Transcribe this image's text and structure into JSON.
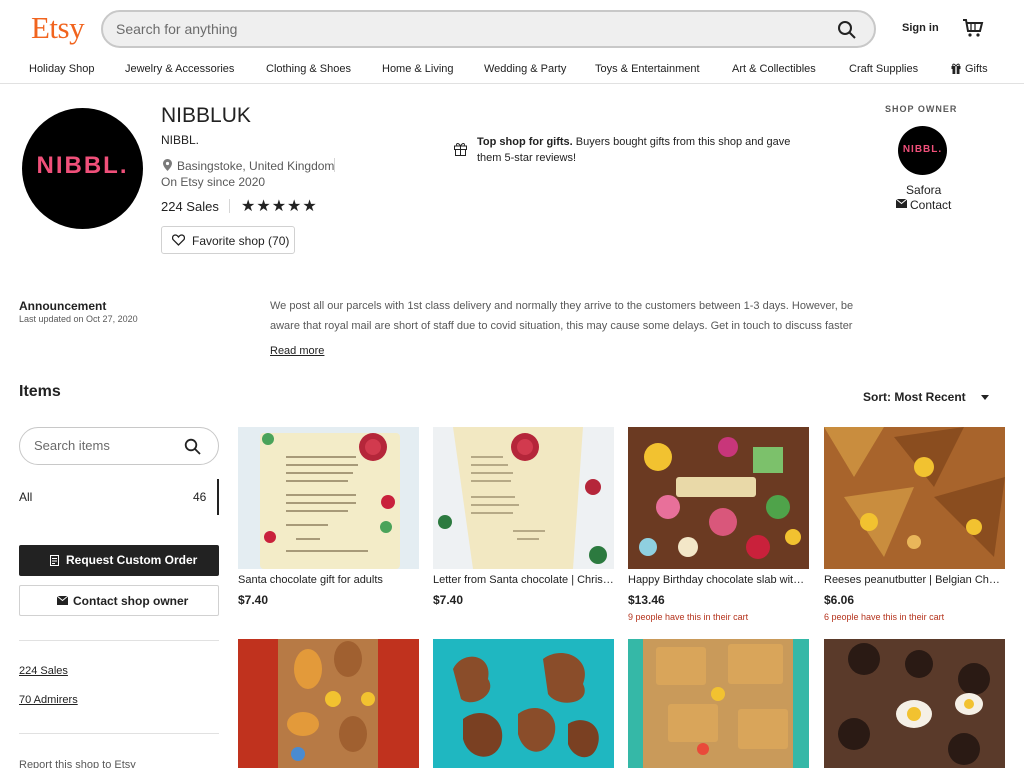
{
  "header": {
    "logo": "Etsy",
    "search_placeholder": "Search for anything",
    "signin": "Sign in"
  },
  "nav": [
    "Holiday Shop",
    "Jewelry & Accessories",
    "Clothing & Shoes",
    "Home & Living",
    "Wedding & Party",
    "Toys & Entertainment",
    "Art & Collectibles",
    "Craft Supplies",
    "Gifts"
  ],
  "shop": {
    "logo_text": "NIBBL.",
    "name": "NIBBLUK",
    "title": "NIBBL.",
    "location": "Basingstoke, United Kingdom",
    "since": "On Etsy since 2020",
    "sales": "224 Sales",
    "stars": "★★★★★",
    "favorite": "Favorite shop (70)",
    "top_shop_bold": "Top shop for gifts.",
    "top_shop_text": " Buyers bought gifts from this shop and gave them 5-star reviews!"
  },
  "owner": {
    "header": "SHOP OWNER",
    "avatar_text": "NIBBL.",
    "name": "Safora",
    "contact": "Contact"
  },
  "announcement": {
    "title": "Announcement",
    "date": "Last updated on Oct 27, 2020",
    "text": "We post all our parcels with 1st class delivery and normally they arrive to the customers between 1-3 days. However, be aware that royal mail are short of staff due to covid situation, this may cause some delays. Get in touch to discuss faster",
    "read_more": "Read more"
  },
  "items": {
    "heading": "Items",
    "sort": "Sort: Most Recent",
    "search_placeholder": "Search items",
    "category": "All",
    "count": "46"
  },
  "sidebar": {
    "request_btn": "Request Custom Order",
    "contact_btn": "Contact shop owner",
    "sales_link": "224 Sales",
    "admirers_link": "70 Admirers",
    "report": "Report this shop to Etsy"
  },
  "products": [
    {
      "title": "Santa chocolate gift for adults",
      "price": "$7.40",
      "note": ""
    },
    {
      "title": "Letter from Santa chocolate | Christmas chocolate",
      "price": "$7.40",
      "note": ""
    },
    {
      "title": "Happy Birthday chocolate slab with personalised name",
      "price": "$13.46",
      "note": "9 people have this in their cart"
    },
    {
      "title": "Reeses peanutbutter | Belgian Chocolate slab",
      "price": "$6.06",
      "note": "6 people have this in their cart"
    }
  ],
  "colors": {
    "brand": "#f1641e",
    "logo_pink": "#f0507a",
    "cart_note": "#b5341e"
  }
}
